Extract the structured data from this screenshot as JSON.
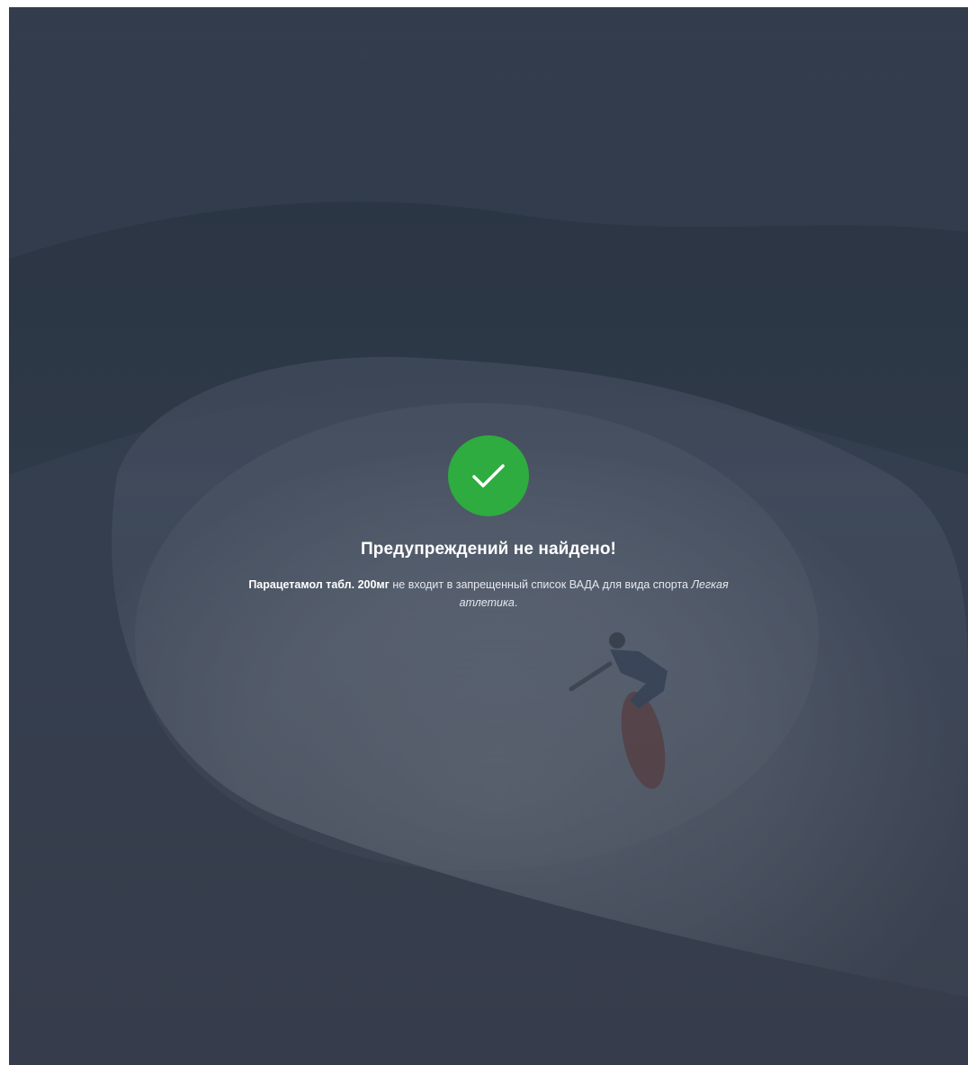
{
  "result": {
    "status_icon": "checkmark-icon",
    "success_color": "#2eac3f",
    "title": "Предупреждений не найдено!",
    "drug_name": "Парацетамол табл. 200мг",
    "message_middle": " не входит в запрещенный список ВАДА для вида спорта ",
    "sport_name": "Легкая атлетика",
    "message_end": "."
  }
}
